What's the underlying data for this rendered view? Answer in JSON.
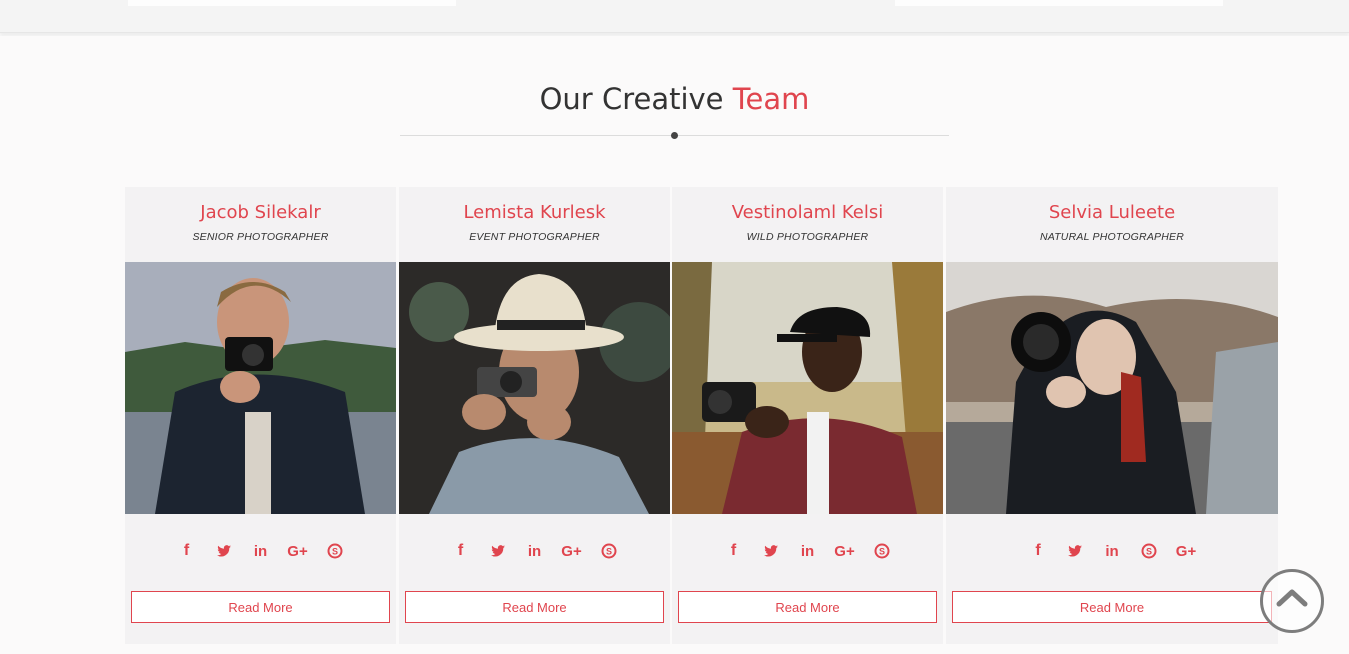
{
  "section": {
    "title_main": "Our Creative",
    "title_accent": "Team"
  },
  "members": [
    {
      "name": "Jacob Silekalr",
      "role": "SENIOR PHOTOGRAPHER",
      "socials": [
        "facebook-icon",
        "twitter-icon",
        "linkedin-icon",
        "google-plus-icon",
        "skype-icon"
      ],
      "read_more": "Read More"
    },
    {
      "name": "Lemista Kurlesk",
      "role": "EVENT PHOTOGRAPHER",
      "socials": [
        "facebook-icon",
        "twitter-icon",
        "linkedin-icon",
        "google-plus-icon",
        "skype-icon"
      ],
      "read_more": "Read More"
    },
    {
      "name": "Vestinolaml Kelsi",
      "role": "WILD PHOTOGRAPHER",
      "socials": [
        "facebook-icon",
        "twitter-icon",
        "linkedin-icon",
        "google-plus-icon",
        "skype-icon"
      ],
      "read_more": "Read More"
    },
    {
      "name": "Selvia Luleete",
      "role": "NATURAL PHOTOGRAPHER",
      "socials": [
        "facebook-icon",
        "twitter-icon",
        "linkedin-icon",
        "skype-icon",
        "google-plus-icon"
      ],
      "read_more": "Read More"
    }
  ],
  "colors": {
    "accent": "#e0454e",
    "card_bg": "#f3f2f3",
    "text_dark": "#333333"
  },
  "scroll_top_icon": "chevron-up-icon"
}
